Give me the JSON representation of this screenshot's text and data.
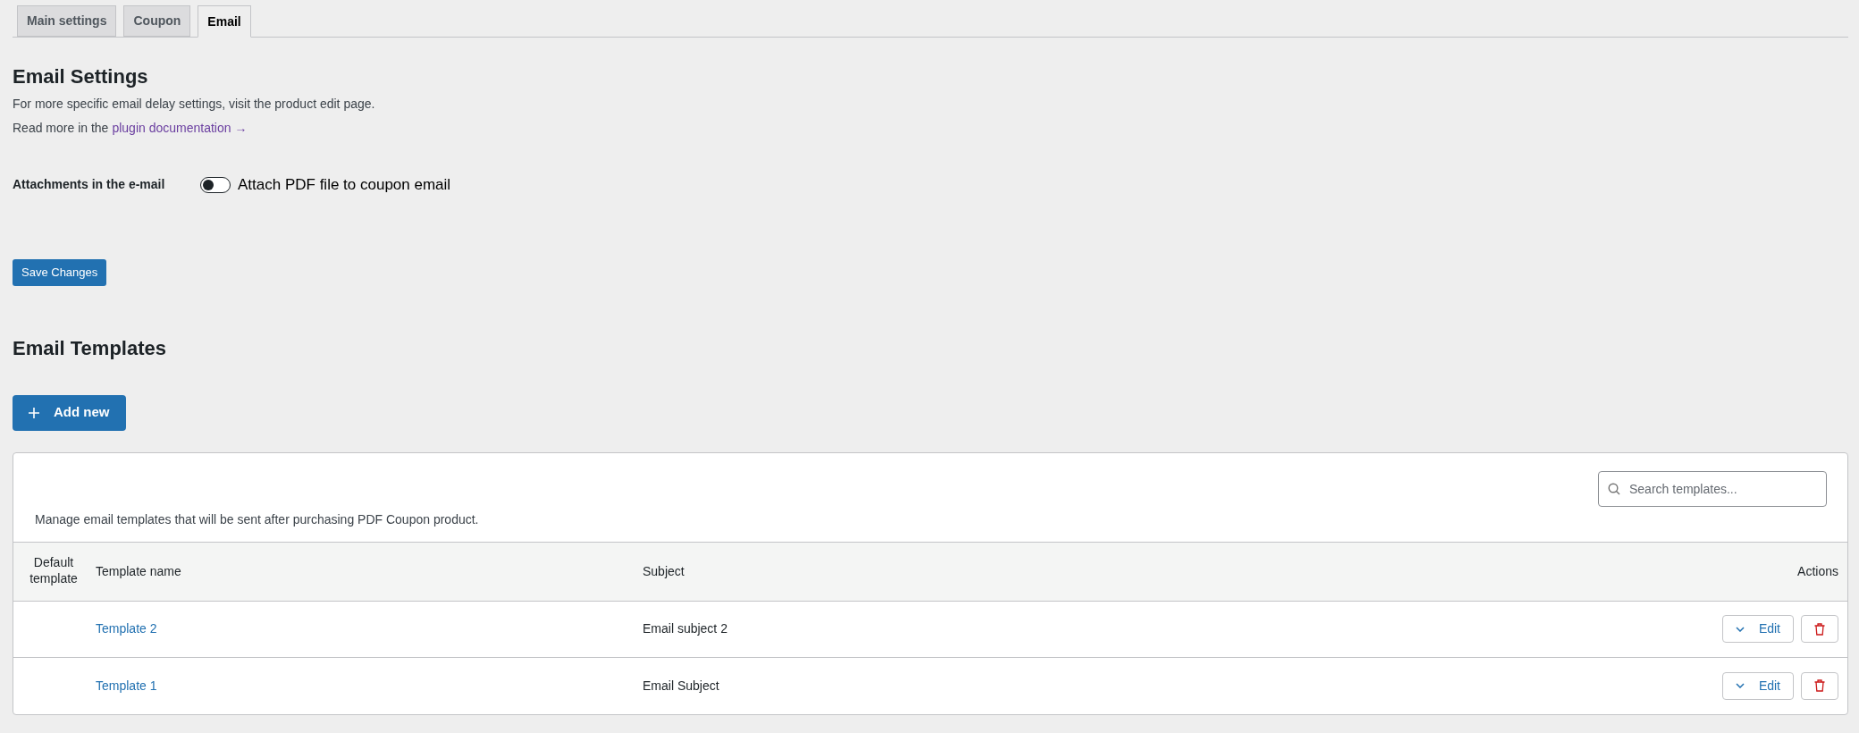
{
  "tabs": [
    {
      "label": "Main settings",
      "selected": false
    },
    {
      "label": "Coupon",
      "selected": false
    },
    {
      "label": "Email",
      "selected": true
    }
  ],
  "email_settings": {
    "title": "Email Settings",
    "description": "For more specific email delay settings, visit the product edit page.",
    "read_more": "Read more in the",
    "link": "plugin documentation →",
    "attachments": {
      "label": "Attachments in the e-mail",
      "toggle_label": "Attach PDF file to coupon email",
      "on": false
    },
    "save_button": "Save Changes"
  },
  "email_templates": {
    "title": "Email Templates",
    "add_button": "Add new",
    "search": {
      "placeholder": "Search templates..."
    },
    "description": "Manage email templates that will be sent after purchasing PDF Coupon product.",
    "columns": [
      "Default template",
      "Template name",
      "Subject",
      "Actions"
    ],
    "rows": [
      {
        "name": "Template 2",
        "subject": "Email subject 2",
        "edit": "Edit"
      },
      {
        "name": "Template 1",
        "subject": "Email Subject",
        "edit": "Edit"
      }
    ]
  }
}
